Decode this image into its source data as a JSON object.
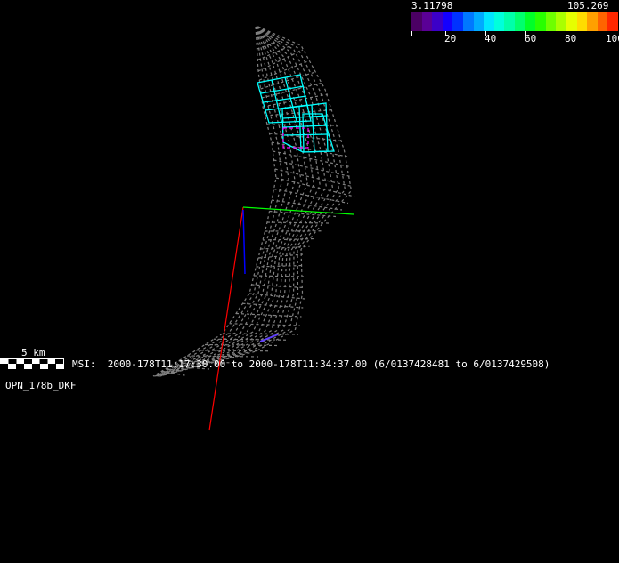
{
  "colorbar": {
    "min_label": "3.11798",
    "max_label": "105.269",
    "ticks": [
      "20",
      "40",
      "60",
      "80",
      "100"
    ],
    "colors": [
      "#4b0064",
      "#5a0096",
      "#3c00c8",
      "#1400ff",
      "#0032ff",
      "#0078ff",
      "#00aaff",
      "#00e6ff",
      "#00ffdc",
      "#00ffaa",
      "#00ff6e",
      "#00ff28",
      "#28ff00",
      "#6eff00",
      "#aaff00",
      "#e6ff00",
      "#ffdc00",
      "#ffa000",
      "#ff6400",
      "#ff2800"
    ]
  },
  "scale_bar": {
    "label": "5 km"
  },
  "info": {
    "line": "MSI:  2000-178T11:17:30.00 to 2000-178T11:34:37.00 (6/0137428481 to 6/0137429508)",
    "label": "OPN_178b_DKF"
  },
  "colors": {
    "wireframe": "#808080",
    "footprint": "#00ffff",
    "axis_x": "#ff0000",
    "axis_y": "#00ff00",
    "axis_z": "#0000ff"
  }
}
